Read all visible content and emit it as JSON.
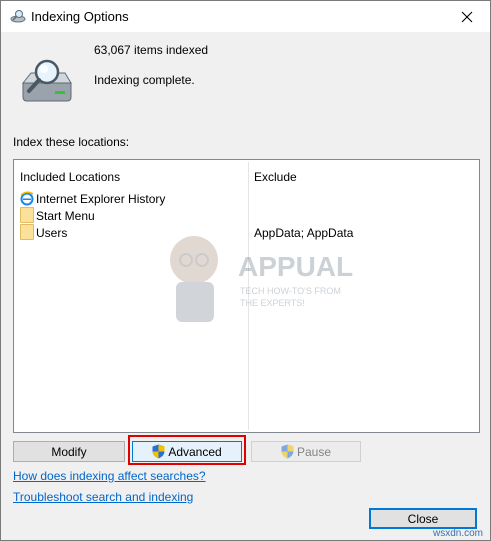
{
  "window": {
    "title": "Indexing Options",
    "close_icon": "close-icon"
  },
  "summary": {
    "items_indexed": "63,067 items indexed",
    "status": "Indexing complete."
  },
  "locations": {
    "label": "Index these locations:",
    "columns": {
      "included": "Included Locations",
      "exclude": "Exclude"
    },
    "rows": [
      {
        "name": "Internet Explorer History",
        "exclude": "",
        "icon": "ie-icon"
      },
      {
        "name": "Start Menu",
        "exclude": "",
        "icon": "folder-icon"
      },
      {
        "name": "Users",
        "exclude": "AppData; AppData",
        "icon": "folder-icon"
      }
    ]
  },
  "watermark": {
    "brand": "APPUALS",
    "tagline_1": "TECH HOW-TO'S FROM",
    "tagline_2": "THE EXPERTS!"
  },
  "buttons": {
    "modify": "Modify",
    "advanced": "Advanced",
    "pause": "Pause",
    "close": "Close"
  },
  "links": {
    "help": "How does indexing affect searches?",
    "troubleshoot": "Troubleshoot search and indexing"
  },
  "credit": "wsxdn.com",
  "colors": {
    "accent": "#0078d7",
    "link": "#0066cc",
    "highlight": "#e10000",
    "folder": "#fbe19a"
  }
}
